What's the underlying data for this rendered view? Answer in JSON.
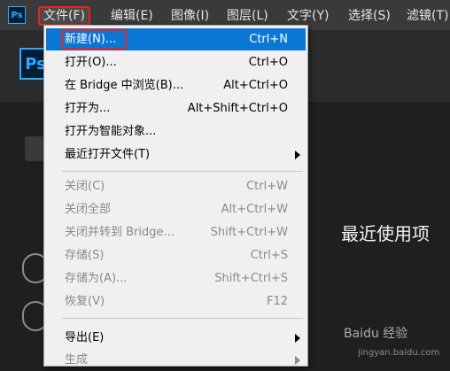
{
  "app": {
    "logo_small": "Ps",
    "logo_big": "Ps"
  },
  "menubar": {
    "items": [
      {
        "label": "文件(F)"
      },
      {
        "label": "编辑(E)"
      },
      {
        "label": "图像(I)"
      },
      {
        "label": "图层(L)"
      },
      {
        "label": "文字(Y)"
      },
      {
        "label": "选择(S)"
      },
      {
        "label": "滤镜(T)"
      }
    ]
  },
  "file_menu": {
    "items": [
      {
        "label": "新建(N)...",
        "shortcut": "Ctrl+N"
      },
      {
        "label": "打开(O)...",
        "shortcut": "Ctrl+O"
      },
      {
        "label": "在 Bridge 中浏览(B)...",
        "shortcut": "Alt+Ctrl+O"
      },
      {
        "label": "打开为...",
        "shortcut": "Alt+Shift+Ctrl+O"
      },
      {
        "label": "打开为智能对象...",
        "shortcut": ""
      },
      {
        "label": "最近打开文件(T)",
        "shortcut": ""
      },
      {
        "label": "关闭(C)",
        "shortcut": "Ctrl+W"
      },
      {
        "label": "关闭全部",
        "shortcut": "Alt+Ctrl+W"
      },
      {
        "label": "关闭并转到 Bridge...",
        "shortcut": "Shift+Ctrl+W"
      },
      {
        "label": "存储(S)",
        "shortcut": "Ctrl+S"
      },
      {
        "label": "存储为(A)...",
        "shortcut": "Shift+Ctrl+S"
      },
      {
        "label": "恢复(V)",
        "shortcut": "F12"
      },
      {
        "label": "导出(E)",
        "shortcut": ""
      },
      {
        "label": "生成",
        "shortcut": ""
      }
    ]
  },
  "workspace": {
    "recent_title": "最近使用项"
  },
  "watermark": {
    "text": "Baidu 经验",
    "sub": "jingyan.baidu.com"
  },
  "colors": {
    "highlight": "#0a77d5",
    "annotation": "#e8231d",
    "ps_blue": "#31a8ff"
  }
}
